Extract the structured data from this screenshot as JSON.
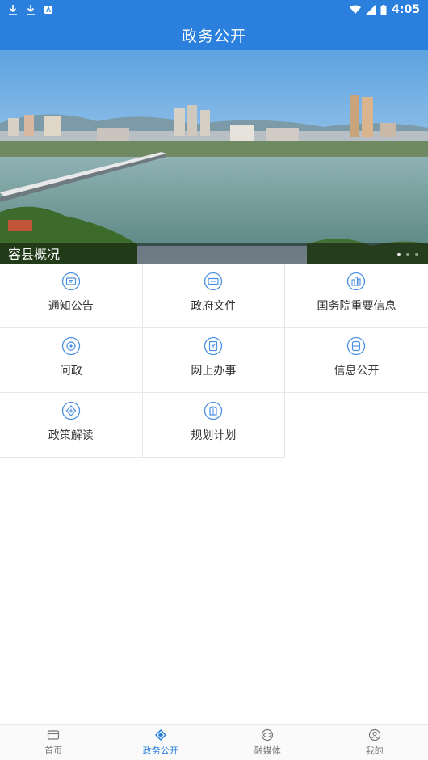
{
  "status_bar": {
    "time": "4:05"
  },
  "header": {
    "title": "政务公开"
  },
  "banner": {
    "caption": "容县概况",
    "dots": 3,
    "active_dot": 0
  },
  "grid": {
    "items": [
      {
        "label": "通知公告",
        "icon": "notice-icon"
      },
      {
        "label": "政府文件",
        "icon": "document-icon"
      },
      {
        "label": "国务院重要信息",
        "icon": "building-icon"
      },
      {
        "label": "问政",
        "icon": "question-icon"
      },
      {
        "label": "网上办事",
        "icon": "service-icon"
      },
      {
        "label": "信息公开",
        "icon": "info-icon"
      },
      {
        "label": "政策解读",
        "icon": "policy-icon"
      },
      {
        "label": "规划计划",
        "icon": "plan-icon"
      }
    ]
  },
  "bottom_nav": {
    "items": [
      {
        "label": "首页",
        "icon": "home-icon",
        "active": false
      },
      {
        "label": "政务公开",
        "icon": "gov-icon",
        "active": true
      },
      {
        "label": "融媒体",
        "icon": "media-icon",
        "active": false
      },
      {
        "label": "我的",
        "icon": "profile-icon",
        "active": false
      }
    ]
  },
  "colors": {
    "primary": "#2b80dd",
    "icon_stroke": "#4a90e2",
    "text": "#333333",
    "nav_inactive": "#777777"
  }
}
